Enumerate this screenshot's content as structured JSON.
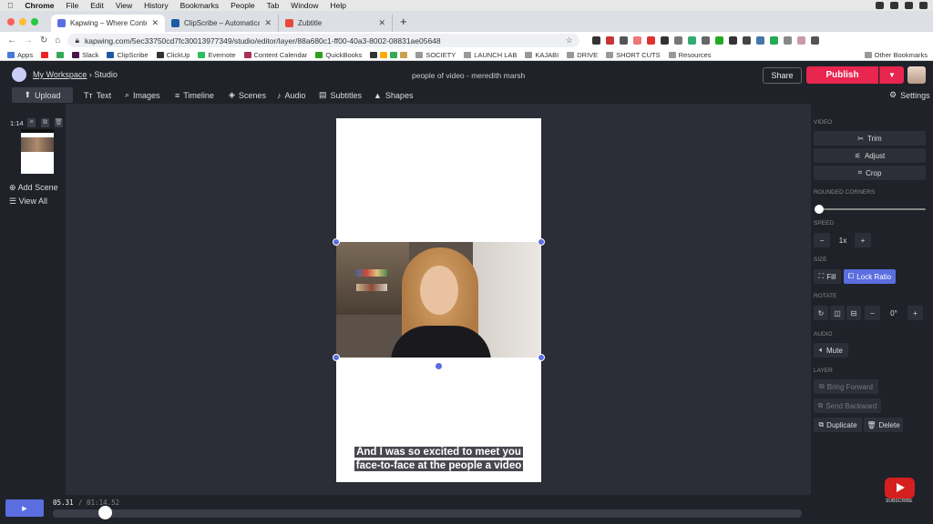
{
  "mac_menu": {
    "apple": "",
    "items": [
      "Chrome",
      "File",
      "Edit",
      "View",
      "History",
      "Bookmarks",
      "People",
      "Tab",
      "Window",
      "Help"
    ]
  },
  "tabs": [
    {
      "title": "Kapwing – Where Content Crea",
      "active": true,
      "color": "#5b6ee0"
    },
    {
      "title": "ClipScribe – Automatically crea",
      "active": false,
      "color": "#1d5aa6"
    },
    {
      "title": "Zubtitle",
      "active": false,
      "color": "#e84a3a"
    }
  ],
  "address": {
    "url": "kapwing.com/5ec33750cd7fc30013977349/studio/editor/layer/88a680c1-ff00-40a3-8002-08831ae05648"
  },
  "bookmarks": {
    "items": [
      "Apps",
      "Slack",
      "ClipScribe",
      "ClickUp",
      "Evernote",
      "Content Calendar",
      "QuickBooks",
      "SOCIETY",
      "LAUNCH LAB",
      "KAJABI",
      "DRIVE",
      "SHORT CUTS",
      "Resources"
    ],
    "other": "Other Bookmarks"
  },
  "header": {
    "workspace": "My Workspace",
    "separator": " › ",
    "studio": "Studio",
    "video_title": "people of video - meredith marsh",
    "share": "Share",
    "publish": "Publish",
    "publish_dropdown_icon": "chevron-down-icon"
  },
  "toolbar": {
    "upload": "Upload",
    "text": "Text",
    "images": "Images",
    "timeline": "Timeline",
    "scenes": "Scenes",
    "audio": "Audio",
    "subtitles": "Subtitles",
    "shapes": "Shapes",
    "settings": "Settings"
  },
  "left_panel": {
    "scene_time": "1:14",
    "add_scene": "Add Scene",
    "view_all": "View All"
  },
  "canvas": {
    "subtitle_line1": "And I was so excited to meet you",
    "subtitle_line2": "face-to-face at the people a video"
  },
  "right_panel": {
    "video_label": "VIDEO",
    "trim": "Trim",
    "adjust": "Adjust",
    "crop": "Crop",
    "rounded_corners_label": "ROUNDED CORNERS",
    "rounded_corners_value": 0,
    "speed_label": "SPEED",
    "speed_value": "1x",
    "size_label": "SIZE",
    "fill": "Fill",
    "lock_ratio": "Lock Ratio",
    "rotate_label": "ROTATE",
    "rotate_value": "0°",
    "audio_label": "AUDIO",
    "mute": "Mute",
    "layer_label": "LAYER",
    "bring_forward": "Bring Forward",
    "send_backward": "Send Backward",
    "duplicate": "Duplicate",
    "delete": "Delete"
  },
  "playback": {
    "current": "05.31",
    "separator": " / ",
    "total": "01:14.52",
    "progress": 0.07
  },
  "overlay": {
    "subscribe": "SUBSCRIBE"
  }
}
